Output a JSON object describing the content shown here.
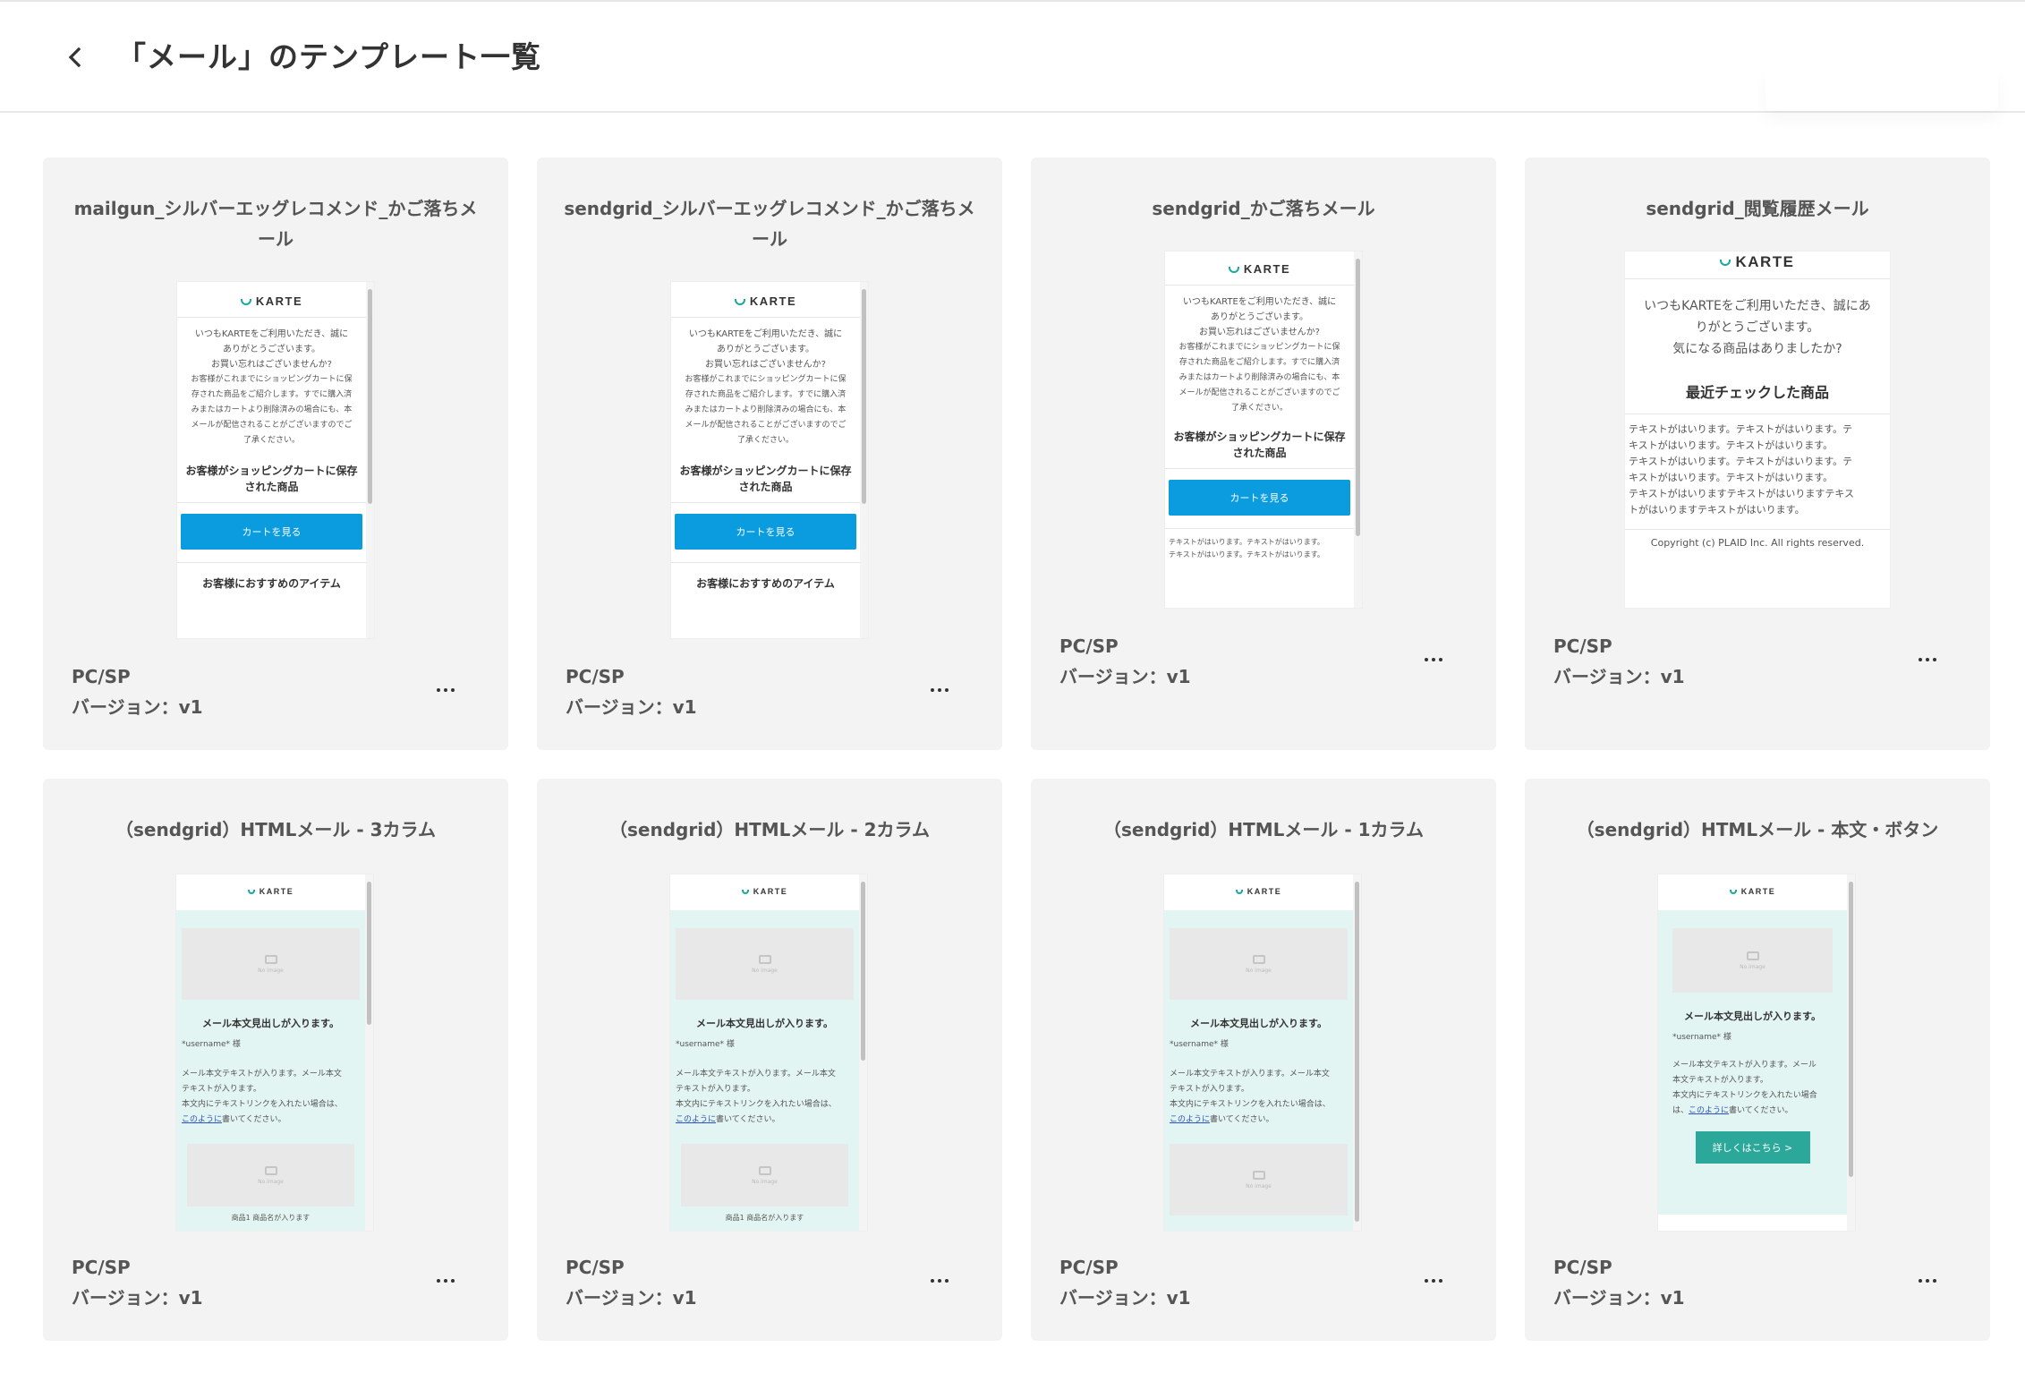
{
  "header": {
    "title": "「メール」のテンプレート一覧"
  },
  "templates": [
    {
      "title": "mailgun_シルバーエッグレコメンド_かご落ちメール",
      "device": "PC/SP",
      "version": "バージョン：v1",
      "preview": {
        "brand": "KARTE",
        "lines": [
          "いつもKARTEをご利用いただき、誠に",
          "ありがとうございます。",
          "お買い忘れはございませんか?",
          "お客様がこれまでにショッピングカートに保",
          "存された商品をご紹介します。すでに購入済",
          "みまたはカートより削除済みの場合にも、本",
          "メールが配信されることがございますのでご",
          "了承ください。"
        ],
        "heading": "お客様がショッピングカートに保存された商品",
        "button": "カートを見る",
        "footer": "お客様におすすめのアイテム"
      }
    },
    {
      "title": "sendgrid_シルバーエッグレコメンド_かご落ちメール",
      "device": "PC/SP",
      "version": "バージョン：v1",
      "preview": {
        "brand": "KARTE",
        "lines": [
          "いつもKARTEをご利用いただき、誠に",
          "ありがとうございます。",
          "お買い忘れはございませんか?",
          "お客様がこれまでにショッピングカートに保",
          "存された商品をご紹介します。すでに購入済",
          "みまたはカートより削除済みの場合にも、本",
          "メールが配信されることがございますのでご",
          "了承ください。"
        ],
        "heading": "お客様がショッピングカートに保存された商品",
        "button": "カートを見る",
        "footer": "お客様におすすめのアイテム"
      }
    },
    {
      "title": "sendgrid_かご落ちメール",
      "device": "PC/SP",
      "version": "バージョン：v1",
      "preview": {
        "brand": "KARTE",
        "lines": [
          "いつもKARTEをご利用いただき、誠に",
          "ありがとうございます。",
          "お買い忘れはございませんか?",
          "お客様がこれまでにショッピングカートに保",
          "存された商品をご紹介します。すでに購入済",
          "みまたはカートより削除済みの場合にも、本",
          "メールが配信されることがございますのでご",
          "了承ください。"
        ],
        "heading": "お客様がショッピングカートに保存された商品",
        "button": "カートを見る",
        "footer_lines": [
          "テキストがはいります。テキストがはいります。",
          "テキストがはいります。テキストがはいります。"
        ]
      }
    },
    {
      "title": "sendgrid_閲覧履歴メール",
      "device": "PC/SP",
      "version": "バージョン：v1",
      "preview": {
        "brand": "KARTE",
        "lines": [
          "いつもKARTEをご利用いただき、誠にあ",
          "りがとうございます。",
          "気になる商品はありましたか?"
        ],
        "heading": "最近チェックした商品",
        "body_lines": [
          "テキストがはいります。テキストがはいります。テ",
          "キストがはいります。テキストがはいります。",
          "テキストがはいります。テキストがはいります。テ",
          "キストがはいります。テキストがはいります。",
          "テキストがはいりますテキストがはいりますテキス",
          "トがはいりますテキストがはいります。"
        ],
        "copyright": "Copyright (c) PLAID Inc. All rights reserved."
      }
    },
    {
      "title": "（sendgrid）HTMLメール - 3カラム",
      "device": "PC/SP",
      "version": "バージョン：v1",
      "preview": {
        "brand": "KARTE",
        "placeholder": "No image",
        "heading": "メール本文見出しが入ります。",
        "username": "*username* 様",
        "lines": [
          "メール本文テキストが入ります。メール本文",
          "テキストが入ります。",
          "本文内にテキストリンクを入れたい場合は、"
        ],
        "link": "このように",
        "link_rest": "書いてください。",
        "footer": "商品1 商品名が入ります"
      }
    },
    {
      "title": "（sendgrid）HTMLメール - 2カラム",
      "device": "PC/SP",
      "version": "バージョン：v1",
      "preview": {
        "brand": "KARTE",
        "placeholder": "No image",
        "heading": "メール本文見出しが入ります。",
        "username": "*username* 様",
        "lines": [
          "メール本文テキストが入ります。メール本文",
          "テキストが入ります。",
          "本文内にテキストリンクを入れたい場合は、"
        ],
        "link": "このように",
        "link_rest": "書いてください。",
        "footer": "商品1 商品名が入ります"
      }
    },
    {
      "title": "（sendgrid）HTMLメール - 1カラム",
      "device": "PC/SP",
      "version": "バージョン：v1",
      "preview": {
        "brand": "KARTE",
        "placeholder": "No image",
        "heading": "メール本文見出しが入ります。",
        "username": "*username* 様",
        "lines": [
          "メール本文テキストが入ります。メール本文",
          "テキストが入ります。",
          "本文内にテキストリンクを入れたい場合は、"
        ],
        "link": "このように",
        "link_rest": "書いてください。"
      }
    },
    {
      "title": "（sendgrid）HTMLメール - 本文・ボタン",
      "device": "PC/SP",
      "version": "バージョン：v1",
      "preview": {
        "brand": "KARTE",
        "placeholder": "No image",
        "heading": "メール本文見出しが入ります。",
        "username": "*username* 様",
        "lines": [
          "メール本文テキストが入ります。メール",
          "本文テキストが入ります。",
          "本文内にテキストリンクを入れたい場合"
        ],
        "link_prefix": "は、",
        "link": "このように",
        "link_rest": "書いてください。",
        "button": "詳しくはこちら >"
      }
    }
  ]
}
